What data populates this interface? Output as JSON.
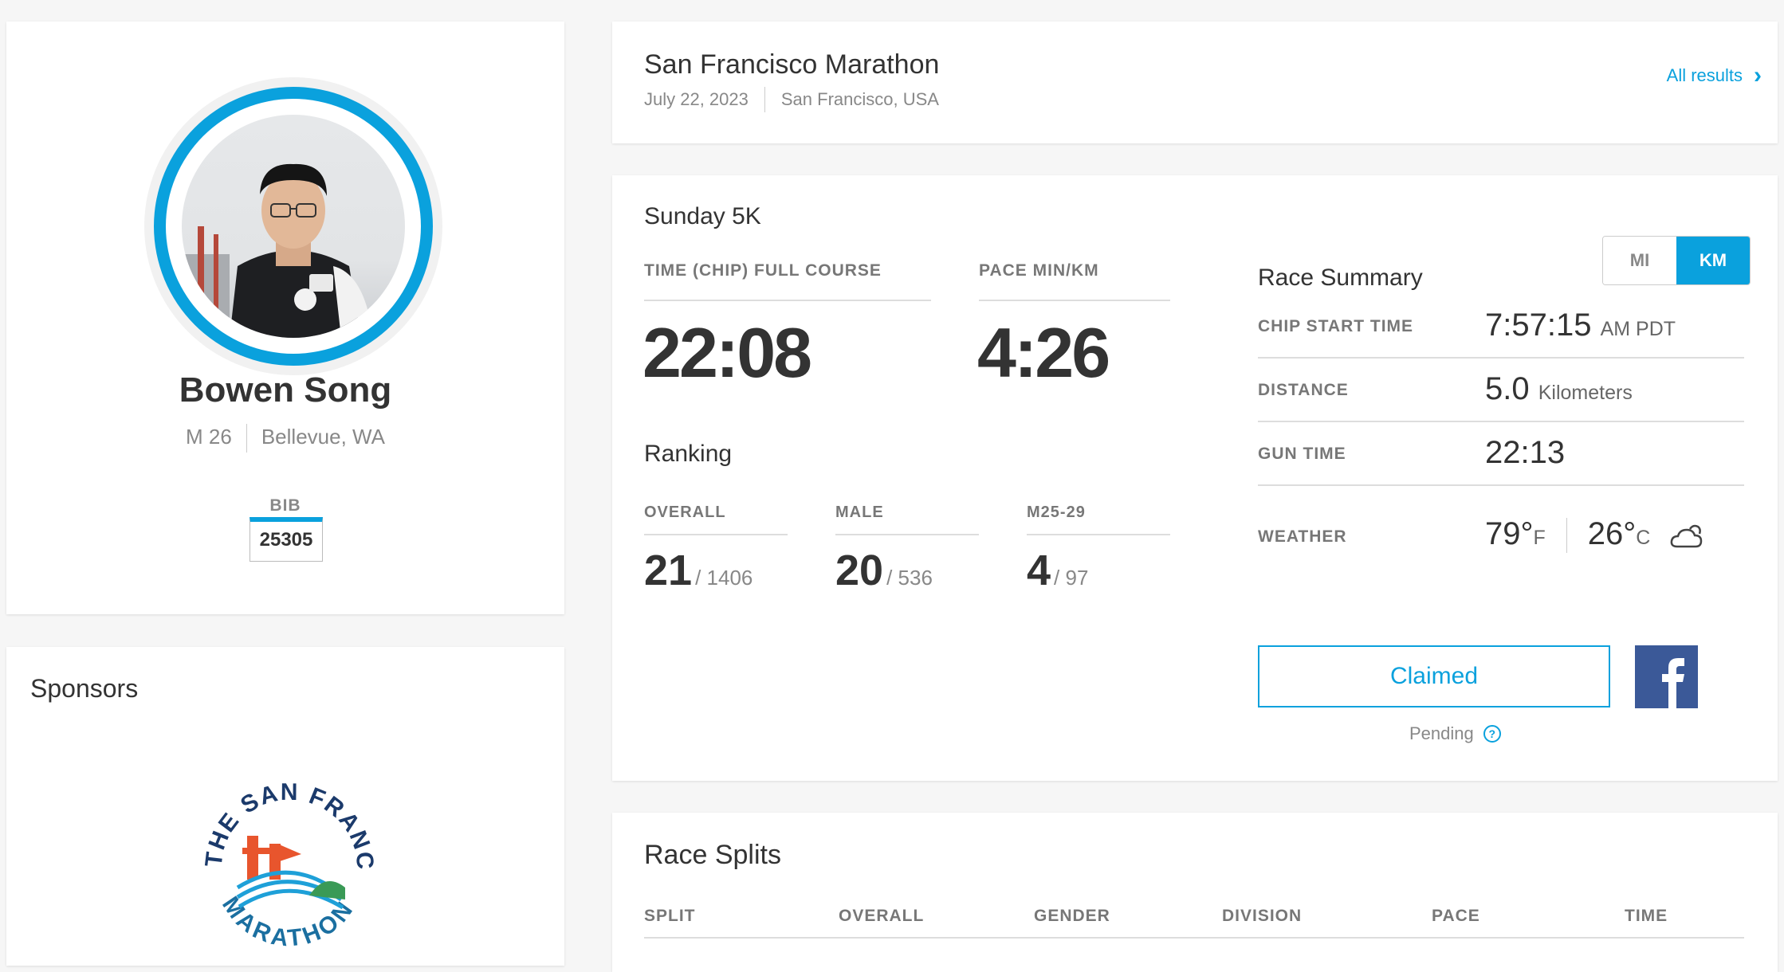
{
  "profile": {
    "name": "Bowen Song",
    "gender_age": "M 26",
    "location": "Bellevue, WA",
    "bib_label": "BIB",
    "bib_number": "25305"
  },
  "sponsors": {
    "title": "Sponsors",
    "logo_text_top": "THE SAN FRANCISCO",
    "logo_text_bottom": "MARATHON"
  },
  "event": {
    "title": "San Francisco Marathon",
    "date": "July 22, 2023",
    "location": "San Francisco, USA",
    "all_results": "All results"
  },
  "result": {
    "race_name": "Sunday 5K",
    "time_label": "TIME (CHIP) FULL COURSE",
    "time_value": "22:08",
    "pace_label": "PACE MIN/KM",
    "pace_value": "4:26",
    "ranking_title": "Ranking",
    "rankings": [
      {
        "label": "OVERALL",
        "place": "21",
        "total": "/ 1406"
      },
      {
        "label": "MALE",
        "place": "20",
        "total": "/ 536"
      },
      {
        "label": "M25-29",
        "place": "4",
        "total": "/ 97"
      }
    ],
    "summary_title": "Race Summary",
    "units": {
      "mi": "MI",
      "km": "KM",
      "selected": "KM"
    },
    "summary": {
      "chip_start_label": "CHIP START TIME",
      "chip_start_value": "7:57:15",
      "chip_start_unit": "AM PDT",
      "distance_label": "DISTANCE",
      "distance_value": "5.0",
      "distance_unit": "Kilometers",
      "gun_label": "GUN TIME",
      "gun_value": "22:13",
      "weather_label": "WEATHER",
      "temp_f": "79°",
      "temp_f_unit": "F",
      "temp_c": "26°",
      "temp_c_unit": "C",
      "weather_icon": "partly-cloudy-icon"
    },
    "claimed_label": "Claimed",
    "pending_label": "Pending",
    "accent_color": "#0aa1dd",
    "facebook_color": "#3b5998"
  },
  "splits": {
    "title": "Race Splits",
    "columns": [
      "SPLIT",
      "OVERALL",
      "GENDER",
      "DIVISION",
      "PACE",
      "TIME"
    ]
  }
}
